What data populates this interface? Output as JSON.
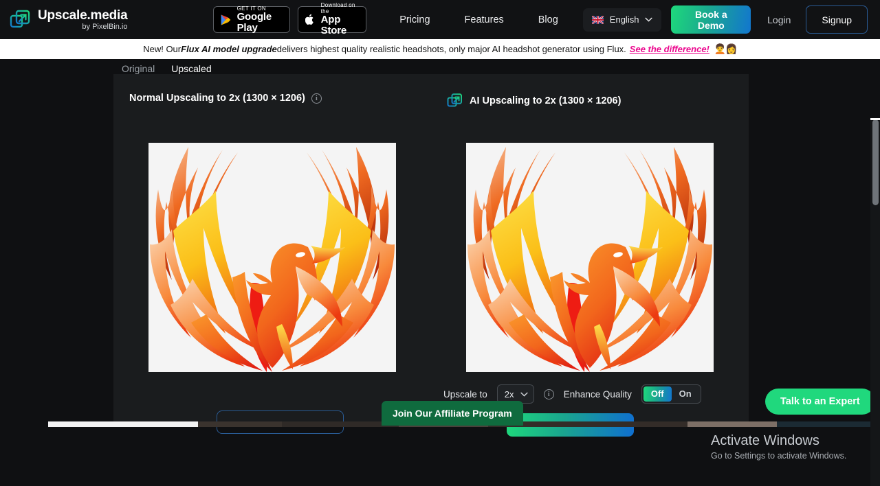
{
  "header": {
    "brand_name": "Upscale.media",
    "brand_sub": "by PixelBin.io",
    "logo_icon": "expand-arrow-icon",
    "google_play": {
      "small": "GET IT ON",
      "big": "Google Play",
      "icon": "google-play-icon"
    },
    "app_store": {
      "small": "Download on the",
      "big": "App Store",
      "icon": "apple-icon"
    },
    "nav": [
      {
        "label": "Pricing"
      },
      {
        "label": "Features"
      },
      {
        "label": "Blog"
      }
    ],
    "language": {
      "label": "English",
      "flag": "uk-flag-icon",
      "chevron": "chevron-down-icon"
    },
    "book_demo": "Book a Demo",
    "login": "Login",
    "signup": "Signup"
  },
  "announcement": {
    "prefix": "New! Our ",
    "bold": "Flux AI model upgrade",
    "middle": " delivers highest quality realistic headshots, only major AI headshot generator using Flux.",
    "cta": "See the difference!",
    "faces": "🧑‍🦱👩"
  },
  "tabs": [
    {
      "label": "Original",
      "active": false
    },
    {
      "label": "Upscaled",
      "active": true
    }
  ],
  "left_panel": {
    "title": "Normal Upscaling to 2x (1300 × 1206)",
    "info_icon": "info-icon",
    "image_alt": "phoenix-logo"
  },
  "right_panel": {
    "mark_icon": "ai-upscale-icon",
    "title": "AI Upscaling to 2x (1300 × 1206)",
    "image_alt": "phoenix-logo"
  },
  "controls": {
    "upscale_to_label": "Upscale to",
    "upscale_to_value": "2x",
    "upscale_info_icon": "info-icon",
    "enhance_label": "Enhance Quality",
    "enhance_options": [
      {
        "label": "Off",
        "selected": true
      },
      {
        "label": "On",
        "selected": false
      }
    ]
  },
  "widgets": {
    "affiliate": "Join Our Affiliate Program",
    "expert": "Talk to an Expert"
  },
  "watermark": {
    "title": "Activate Windows",
    "subtitle": "Go to Settings to activate Windows."
  },
  "colors": {
    "accent_green": "#1fd47e",
    "accent_blue": "#1276cf",
    "page_bg": "#0f1012",
    "panel_bg": "#1a1c1e",
    "cta_pink": "#ec098f"
  }
}
